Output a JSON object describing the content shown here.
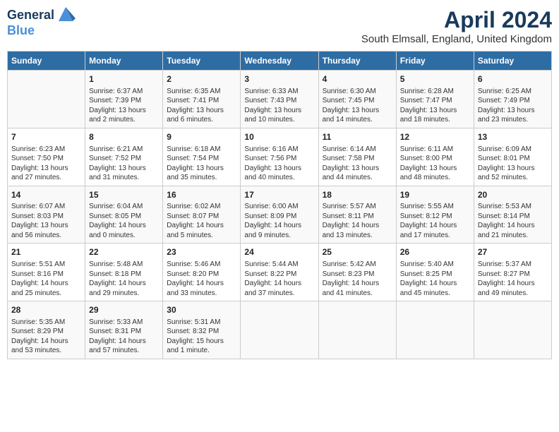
{
  "header": {
    "logo_line1": "General",
    "logo_line2": "Blue",
    "month": "April 2024",
    "location": "South Elmsall, England, United Kingdom"
  },
  "days_of_week": [
    "Sunday",
    "Monday",
    "Tuesday",
    "Wednesday",
    "Thursday",
    "Friday",
    "Saturday"
  ],
  "weeks": [
    [
      {
        "day": "",
        "sunrise": "",
        "sunset": "",
        "daylight": ""
      },
      {
        "day": "1",
        "sunrise": "Sunrise: 6:37 AM",
        "sunset": "Sunset: 7:39 PM",
        "daylight": "Daylight: 13 hours and 2 minutes."
      },
      {
        "day": "2",
        "sunrise": "Sunrise: 6:35 AM",
        "sunset": "Sunset: 7:41 PM",
        "daylight": "Daylight: 13 hours and 6 minutes."
      },
      {
        "day": "3",
        "sunrise": "Sunrise: 6:33 AM",
        "sunset": "Sunset: 7:43 PM",
        "daylight": "Daylight: 13 hours and 10 minutes."
      },
      {
        "day": "4",
        "sunrise": "Sunrise: 6:30 AM",
        "sunset": "Sunset: 7:45 PM",
        "daylight": "Daylight: 13 hours and 14 minutes."
      },
      {
        "day": "5",
        "sunrise": "Sunrise: 6:28 AM",
        "sunset": "Sunset: 7:47 PM",
        "daylight": "Daylight: 13 hours and 18 minutes."
      },
      {
        "day": "6",
        "sunrise": "Sunrise: 6:25 AM",
        "sunset": "Sunset: 7:49 PM",
        "daylight": "Daylight: 13 hours and 23 minutes."
      }
    ],
    [
      {
        "day": "7",
        "sunrise": "Sunrise: 6:23 AM",
        "sunset": "Sunset: 7:50 PM",
        "daylight": "Daylight: 13 hours and 27 minutes."
      },
      {
        "day": "8",
        "sunrise": "Sunrise: 6:21 AM",
        "sunset": "Sunset: 7:52 PM",
        "daylight": "Daylight: 13 hours and 31 minutes."
      },
      {
        "day": "9",
        "sunrise": "Sunrise: 6:18 AM",
        "sunset": "Sunset: 7:54 PM",
        "daylight": "Daylight: 13 hours and 35 minutes."
      },
      {
        "day": "10",
        "sunrise": "Sunrise: 6:16 AM",
        "sunset": "Sunset: 7:56 PM",
        "daylight": "Daylight: 13 hours and 40 minutes."
      },
      {
        "day": "11",
        "sunrise": "Sunrise: 6:14 AM",
        "sunset": "Sunset: 7:58 PM",
        "daylight": "Daylight: 13 hours and 44 minutes."
      },
      {
        "day": "12",
        "sunrise": "Sunrise: 6:11 AM",
        "sunset": "Sunset: 8:00 PM",
        "daylight": "Daylight: 13 hours and 48 minutes."
      },
      {
        "day": "13",
        "sunrise": "Sunrise: 6:09 AM",
        "sunset": "Sunset: 8:01 PM",
        "daylight": "Daylight: 13 hours and 52 minutes."
      }
    ],
    [
      {
        "day": "14",
        "sunrise": "Sunrise: 6:07 AM",
        "sunset": "Sunset: 8:03 PM",
        "daylight": "Daylight: 13 hours and 56 minutes."
      },
      {
        "day": "15",
        "sunrise": "Sunrise: 6:04 AM",
        "sunset": "Sunset: 8:05 PM",
        "daylight": "Daylight: 14 hours and 0 minutes."
      },
      {
        "day": "16",
        "sunrise": "Sunrise: 6:02 AM",
        "sunset": "Sunset: 8:07 PM",
        "daylight": "Daylight: 14 hours and 5 minutes."
      },
      {
        "day": "17",
        "sunrise": "Sunrise: 6:00 AM",
        "sunset": "Sunset: 8:09 PM",
        "daylight": "Daylight: 14 hours and 9 minutes."
      },
      {
        "day": "18",
        "sunrise": "Sunrise: 5:57 AM",
        "sunset": "Sunset: 8:11 PM",
        "daylight": "Daylight: 14 hours and 13 minutes."
      },
      {
        "day": "19",
        "sunrise": "Sunrise: 5:55 AM",
        "sunset": "Sunset: 8:12 PM",
        "daylight": "Daylight: 14 hours and 17 minutes."
      },
      {
        "day": "20",
        "sunrise": "Sunrise: 5:53 AM",
        "sunset": "Sunset: 8:14 PM",
        "daylight": "Daylight: 14 hours and 21 minutes."
      }
    ],
    [
      {
        "day": "21",
        "sunrise": "Sunrise: 5:51 AM",
        "sunset": "Sunset: 8:16 PM",
        "daylight": "Daylight: 14 hours and 25 minutes."
      },
      {
        "day": "22",
        "sunrise": "Sunrise: 5:48 AM",
        "sunset": "Sunset: 8:18 PM",
        "daylight": "Daylight: 14 hours and 29 minutes."
      },
      {
        "day": "23",
        "sunrise": "Sunrise: 5:46 AM",
        "sunset": "Sunset: 8:20 PM",
        "daylight": "Daylight: 14 hours and 33 minutes."
      },
      {
        "day": "24",
        "sunrise": "Sunrise: 5:44 AM",
        "sunset": "Sunset: 8:22 PM",
        "daylight": "Daylight: 14 hours and 37 minutes."
      },
      {
        "day": "25",
        "sunrise": "Sunrise: 5:42 AM",
        "sunset": "Sunset: 8:23 PM",
        "daylight": "Daylight: 14 hours and 41 minutes."
      },
      {
        "day": "26",
        "sunrise": "Sunrise: 5:40 AM",
        "sunset": "Sunset: 8:25 PM",
        "daylight": "Daylight: 14 hours and 45 minutes."
      },
      {
        "day": "27",
        "sunrise": "Sunrise: 5:37 AM",
        "sunset": "Sunset: 8:27 PM",
        "daylight": "Daylight: 14 hours and 49 minutes."
      }
    ],
    [
      {
        "day": "28",
        "sunrise": "Sunrise: 5:35 AM",
        "sunset": "Sunset: 8:29 PM",
        "daylight": "Daylight: 14 hours and 53 minutes."
      },
      {
        "day": "29",
        "sunrise": "Sunrise: 5:33 AM",
        "sunset": "Sunset: 8:31 PM",
        "daylight": "Daylight: 14 hours and 57 minutes."
      },
      {
        "day": "30",
        "sunrise": "Sunrise: 5:31 AM",
        "sunset": "Sunset: 8:32 PM",
        "daylight": "Daylight: 15 hours and 1 minute."
      },
      {
        "day": "",
        "sunrise": "",
        "sunset": "",
        "daylight": ""
      },
      {
        "day": "",
        "sunrise": "",
        "sunset": "",
        "daylight": ""
      },
      {
        "day": "",
        "sunrise": "",
        "sunset": "",
        "daylight": ""
      },
      {
        "day": "",
        "sunrise": "",
        "sunset": "",
        "daylight": ""
      }
    ]
  ]
}
